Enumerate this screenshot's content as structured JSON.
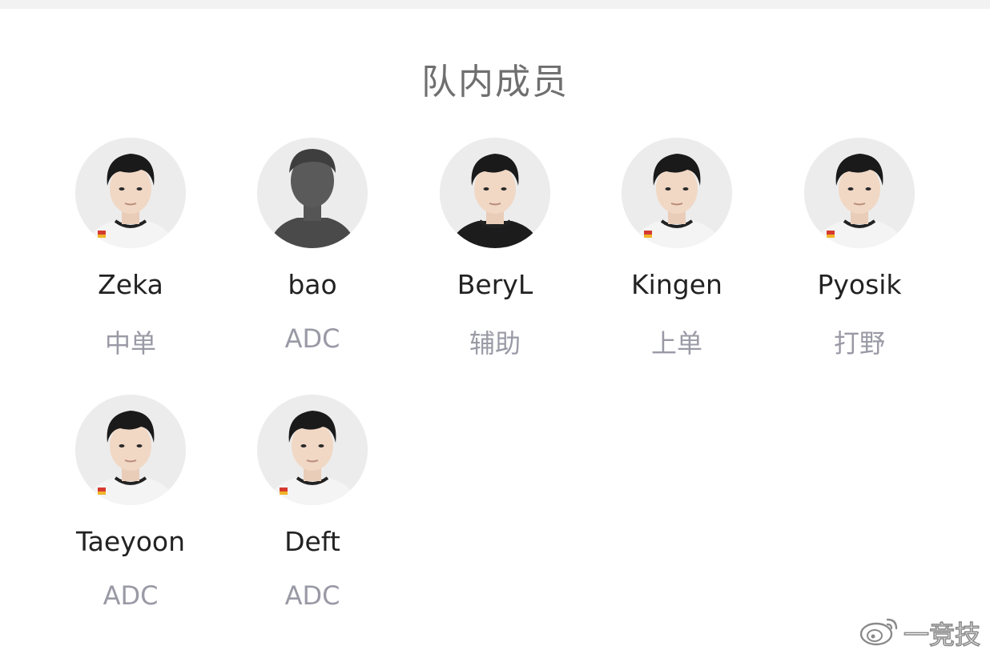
{
  "page": {
    "title": "队内成员"
  },
  "colors": {
    "background": "#ffffff",
    "title": "#6f6f6f",
    "name": "#222222",
    "role": "#9a9aa6",
    "avatar_bg": "#ececec"
  },
  "members": [
    {
      "name": "Zeka",
      "role": "中单",
      "avatar": "player-photo",
      "jersey": "white"
    },
    {
      "name": "bao",
      "role": "ADC",
      "avatar": "silhouette-placeholder",
      "jersey": "dark"
    },
    {
      "name": "BeryL",
      "role": "辅助",
      "avatar": "player-photo",
      "jersey": "black"
    },
    {
      "name": "Kingen",
      "role": "上单",
      "avatar": "player-photo",
      "jersey": "white"
    },
    {
      "name": "Pyosik",
      "role": "打野",
      "avatar": "player-photo",
      "jersey": "white"
    },
    {
      "name": "Taeyoon",
      "role": "ADC",
      "avatar": "player-photo",
      "jersey": "white"
    },
    {
      "name": "Deft",
      "role": "ADC",
      "avatar": "player-photo",
      "jersey": "white"
    }
  ],
  "watermark": {
    "icon": "weibo-icon",
    "text": "一竞技"
  }
}
